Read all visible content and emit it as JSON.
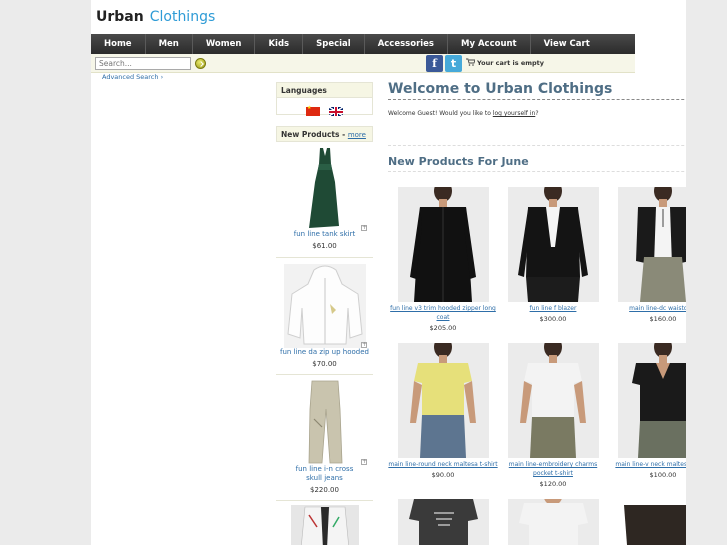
{
  "logo": {
    "part1": "Urban",
    "part2": "Clothings"
  },
  "nav": [
    "Home",
    "Men",
    "Women",
    "Kids",
    "Special",
    "Accessories",
    "My Account",
    "View Cart"
  ],
  "search": {
    "placeholder": "Search...",
    "advanced": "Advanced Search ›"
  },
  "cart": {
    "status": "Your cart is empty"
  },
  "social": {
    "facebook": "f",
    "twitter": "t"
  },
  "languages": {
    "title": "Languages"
  },
  "sidebar_new": {
    "title": "New Products -",
    "more": "more",
    "items": [
      {
        "name": "fun line tank skirt",
        "price": "$61.00"
      },
      {
        "name": "fun line da zip up hooded",
        "price": "$70.00"
      },
      {
        "name": "fun line i-n cross skull jeans",
        "price": "$220.00"
      }
    ]
  },
  "welcome": {
    "title": "Welcome to Urban Clothings",
    "text_before": "Welcome Guest! Would you like to ",
    "link": "log yourself in",
    "text_after": "?"
  },
  "new_products_title": "New Products For June",
  "products": [
    {
      "name": "fun line v3 trim hooded zipper long coat",
      "price": "$205.00"
    },
    {
      "name": "fun line f blazer",
      "price": "$300.00"
    },
    {
      "name": "main line-dc waistcoat",
      "price": "$160.00"
    },
    {
      "name": "main line-round neck maltesa t-shirt",
      "price": "$90.00"
    },
    {
      "name": "main line-embroidery charms pocket t-shirt",
      "price": "$120.00"
    },
    {
      "name": "main line-v neck maltesa t-shirt",
      "price": "$100.00"
    }
  ]
}
